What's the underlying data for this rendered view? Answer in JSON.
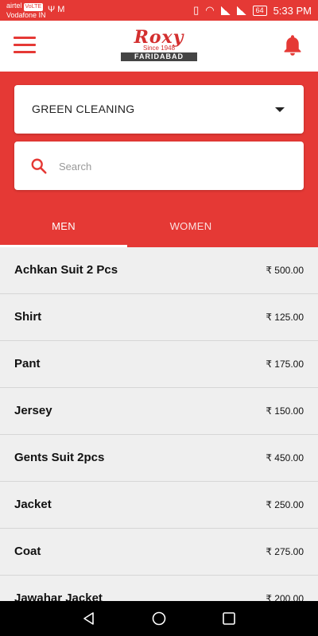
{
  "statusbar": {
    "carrier1": "airtel",
    "volte": "VoLTE",
    "carrier2": "Vodafone IN",
    "left_icons": "Ψ M",
    "battery": "64",
    "time": "5:33 PM"
  },
  "appbar": {
    "logo_main": "Roxy",
    "logo_since": "Since 1948",
    "logo_city": "FARIDABAD",
    "menu_icon": "hamburger-icon",
    "bell_icon": "bell-icon"
  },
  "filter": {
    "selected": "GREEN CLEANING"
  },
  "search": {
    "placeholder": "Search",
    "value": ""
  },
  "tabs": [
    {
      "label": "MEN",
      "active": true
    },
    {
      "label": "WOMEN",
      "active": false
    }
  ],
  "items": [
    {
      "name": "Achkan Suit 2 Pcs",
      "price": "₹ 500.00"
    },
    {
      "name": "Shirt",
      "price": "₹ 125.00"
    },
    {
      "name": "Pant",
      "price": "₹ 175.00"
    },
    {
      "name": "Jersey",
      "price": "₹ 150.00"
    },
    {
      "name": "Gents Suit 2pcs",
      "price": "₹ 450.00"
    },
    {
      "name": "Jacket",
      "price": "₹ 250.00"
    },
    {
      "name": "Coat",
      "price": "₹ 275.00"
    },
    {
      "name": "Jawahar Jacket",
      "price": "₹ 200.00"
    }
  ],
  "colors": {
    "accent": "#e53935",
    "list_bg": "#efefef"
  }
}
